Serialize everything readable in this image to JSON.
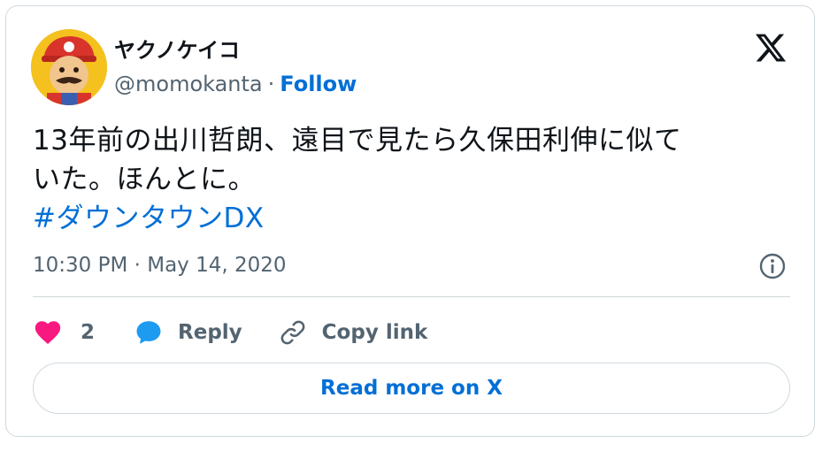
{
  "author": {
    "display_name": "ヤクノケイコ",
    "handle": "@momokanta",
    "separator": "·",
    "follow_label": "Follow"
  },
  "tweet": {
    "text_line1": "13年前の出川哲朗、遠目で見たら久保田利伸に似て",
    "text_line2": "いた。ほんとに。",
    "hashtag": "#ダウンタウンDX",
    "timestamp": "10:30 PM · May 14, 2020"
  },
  "actions": {
    "like_count": "2",
    "reply_label": "Reply",
    "copy_link_label": "Copy link"
  },
  "read_more_label": "Read more on X",
  "colors": {
    "link": "#006fd6",
    "like_heart": "#f91880",
    "reply_bubble": "#1d9bf0",
    "secondary_text": "#536471",
    "border": "#cfd9de"
  },
  "icons": {
    "logo": "x-logo-icon",
    "like": "heart-icon",
    "reply": "speech-bubble-icon",
    "copy": "link-icon",
    "info": "info-icon"
  }
}
